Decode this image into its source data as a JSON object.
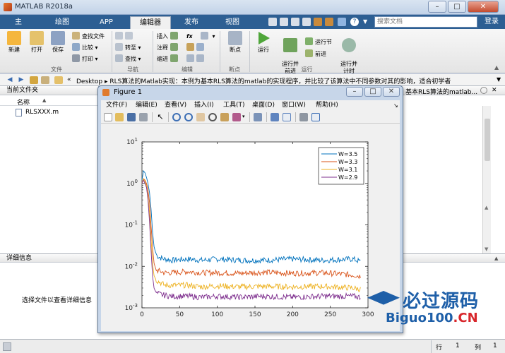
{
  "window": {
    "title": "MATLAB R2018a",
    "min": "–",
    "max": "□",
    "close": "✕"
  },
  "tabs": [
    {
      "label": "主页"
    },
    {
      "label": "绘图"
    },
    {
      "label": "APP"
    },
    {
      "label": "编辑器"
    },
    {
      "label": "发布"
    },
    {
      "label": "视图"
    }
  ],
  "search": {
    "placeholder": "搜索文档",
    "login": "登录"
  },
  "ribbon": {
    "file": {
      "group": "文件",
      "new": "新建",
      "open": "打开",
      "save": "保存",
      "find_files": "查找文件",
      "compare": "比较",
      "print": "打印"
    },
    "nav": {
      "group": "导航",
      "goto": "转至",
      "find": "查找"
    },
    "edit": {
      "group": "编辑",
      "insert": "插入",
      "comment": "注释",
      "indent": "缩进",
      "fx": "fx"
    },
    "breakpoints": {
      "group": "断点",
      "label": "断点"
    },
    "run": {
      "group": "运行",
      "run": "运行",
      "run_advance": "运行并\n前进",
      "run_section": "运行节",
      "advance": "前进",
      "run_time": "运行并\n计时"
    }
  },
  "address": {
    "sep": "«",
    "path": "Desktop  ▸  RLS算法的Matlab实现：本例为基本RLS算法的matlab的实现程序，并比较了该算法中不同参数对其的影响，适合初学者"
  },
  "current_folder": {
    "title": "当前文件夹",
    "col_name": "名称",
    "sort": "▲",
    "files": [
      "RLSXXX.m"
    ]
  },
  "right_panel": {
    "tab_text": "基本RLS算法的matlab..."
  },
  "details": {
    "title": "详细信息",
    "hint": "选择文件以查看详细信息"
  },
  "status": {
    "row_label": "行",
    "row": "1",
    "col_label": "列",
    "col": "1"
  },
  "figure": {
    "title": "Figure 1",
    "menu": [
      "文件(F)",
      "编辑(E)",
      "查看(V)",
      "插入(I)",
      "工具(T)",
      "桌面(D)",
      "窗口(W)",
      "帮助(H)"
    ]
  },
  "watermark": {
    "text1": "必过源码",
    "text2": "Biguo100",
    "text3": ".CN"
  },
  "chart_data": {
    "type": "line",
    "title": "",
    "xlabel": "",
    "ylabel": "",
    "xlim": [
      0,
      300
    ],
    "ylim": [
      0.001,
      10
    ],
    "yscale": "log",
    "xticks": [
      "0",
      "50",
      "100",
      "150",
      "200",
      "250",
      "300"
    ],
    "yticks": [
      "10^1",
      "10^0",
      "10^-1",
      "10^-2",
      "10^-3"
    ],
    "legend_position": "top-right",
    "series": [
      {
        "name": "W=3.5",
        "color": "#0072bd",
        "x": [
          0,
          2,
          4,
          6,
          8,
          10,
          12,
          14,
          16,
          18,
          20,
          25,
          30,
          40,
          60,
          80,
          100,
          130,
          160,
          200,
          240,
          280,
          290
        ],
        "y": [
          1.2,
          2.0,
          1.8,
          1.4,
          1.0,
          0.6,
          0.25,
          0.07,
          0.03,
          0.022,
          0.018,
          0.016,
          0.015,
          0.014,
          0.015,
          0.014,
          0.015,
          0.014,
          0.014,
          0.015,
          0.014,
          0.015,
          0.013
        ]
      },
      {
        "name": "W=3.3",
        "color": "#d95319",
        "x": [
          0,
          2,
          4,
          6,
          8,
          10,
          12,
          14,
          16,
          18,
          20,
          25,
          30,
          40,
          60,
          80,
          100,
          130,
          160,
          200,
          240,
          280,
          290
        ],
        "y": [
          1.0,
          1.3,
          1.2,
          1.0,
          0.7,
          0.35,
          0.1,
          0.03,
          0.012,
          0.009,
          0.008,
          0.0075,
          0.007,
          0.007,
          0.0075,
          0.007,
          0.007,
          0.0068,
          0.0072,
          0.0068,
          0.007,
          0.0062,
          0.0058
        ]
      },
      {
        "name": "W=3.1",
        "color": "#edb120",
        "x": [
          0,
          2,
          4,
          6,
          8,
          10,
          12,
          14,
          16,
          18,
          20,
          25,
          30,
          40,
          60,
          80,
          100,
          130,
          160,
          200,
          240,
          280,
          290
        ],
        "y": [
          1.0,
          1.3,
          1.1,
          0.9,
          0.5,
          0.2,
          0.05,
          0.012,
          0.006,
          0.005,
          0.0045,
          0.004,
          0.0035,
          0.0035,
          0.0035,
          0.0032,
          0.0034,
          0.0032,
          0.0033,
          0.0032,
          0.0033,
          0.003,
          0.0028
        ]
      },
      {
        "name": "W=2.9",
        "color": "#7e2f8e",
        "x": [
          0,
          2,
          4,
          6,
          8,
          10,
          12,
          14,
          16,
          18,
          20,
          25,
          30,
          40,
          60,
          80,
          100,
          130,
          160,
          200,
          240,
          280,
          290
        ],
        "y": [
          1.0,
          1.2,
          1.0,
          0.8,
          0.4,
          0.12,
          0.025,
          0.006,
          0.003,
          0.0025,
          0.0022,
          0.0021,
          0.002,
          0.0019,
          0.0019,
          0.0018,
          0.0019,
          0.0018,
          0.0019,
          0.0018,
          0.0019,
          0.0019,
          0.0018
        ]
      }
    ]
  }
}
